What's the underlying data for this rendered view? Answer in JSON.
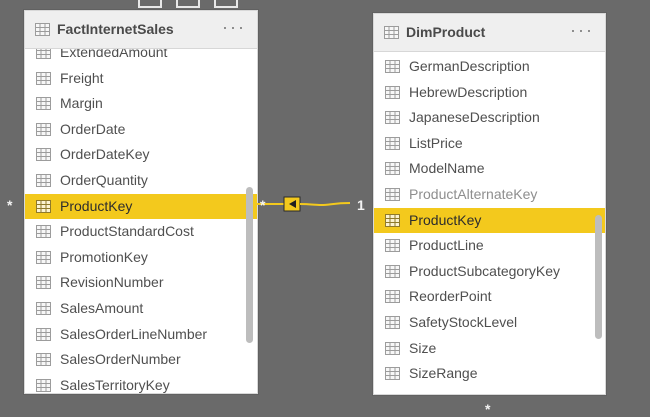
{
  "colors": {
    "canvas_background": "#6a6a6a",
    "card_background": "#ffffff",
    "header_background": "#efefef",
    "selected_row": "#f3c91d",
    "text": "#4f4f4f",
    "muted_text": "#8e8e8e",
    "scrollbar": "#bdbdbd",
    "relationship": "#f3c91d",
    "marker_text": "#f3f3f3"
  },
  "tables": {
    "fact": {
      "title": "FactInternetSales",
      "more": "···",
      "fields": [
        {
          "label": "ExtendedAmount",
          "state": "normal"
        },
        {
          "label": "Freight",
          "state": "normal"
        },
        {
          "label": "Margin",
          "state": "normal"
        },
        {
          "label": "OrderDate",
          "state": "normal"
        },
        {
          "label": "OrderDateKey",
          "state": "normal"
        },
        {
          "label": "OrderQuantity",
          "state": "normal"
        },
        {
          "label": "ProductKey",
          "state": "selected"
        },
        {
          "label": "ProductStandardCost",
          "state": "normal"
        },
        {
          "label": "PromotionKey",
          "state": "normal"
        },
        {
          "label": "RevisionNumber",
          "state": "normal"
        },
        {
          "label": "SalesAmount",
          "state": "normal"
        },
        {
          "label": "SalesOrderLineNumber",
          "state": "normal"
        },
        {
          "label": "SalesOrderNumber",
          "state": "normal"
        },
        {
          "label": "SalesTerritoryKey",
          "state": "normal"
        }
      ]
    },
    "dim": {
      "title": "DimProduct",
      "more": "···",
      "fields": [
        {
          "label": "GermanDescription",
          "state": "normal"
        },
        {
          "label": "HebrewDescription",
          "state": "normal"
        },
        {
          "label": "JapaneseDescription",
          "state": "normal"
        },
        {
          "label": "ListPrice",
          "state": "normal"
        },
        {
          "label": "ModelName",
          "state": "normal"
        },
        {
          "label": "ProductAlternateKey",
          "state": "muted"
        },
        {
          "label": "ProductKey",
          "state": "selected"
        },
        {
          "label": "ProductLine",
          "state": "normal"
        },
        {
          "label": "ProductSubcategoryKey",
          "state": "normal"
        },
        {
          "label": "ReorderPoint",
          "state": "normal"
        },
        {
          "label": "SafetyStockLevel",
          "state": "normal"
        },
        {
          "label": "Size",
          "state": "normal"
        },
        {
          "label": "SizeRange",
          "state": "normal"
        }
      ]
    }
  },
  "relationship": {
    "left_outer_cardinality": "*",
    "left_cardinality": "*",
    "right_cardinality": "1",
    "bottom_cardinality": "*"
  },
  "icons": {
    "table": "table-icon",
    "field": "field-icon",
    "more": "more-options-icon",
    "relationship": "relationship-arrow-icon"
  }
}
